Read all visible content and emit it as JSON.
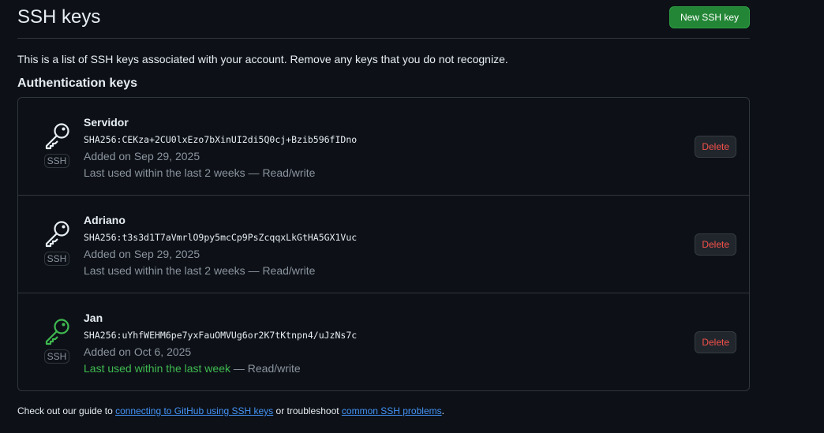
{
  "header": {
    "title": "SSH keys",
    "new_button": "New SSH key"
  },
  "intro": "This is a list of SSH keys associated with your account. Remove any keys that you do not recognize.",
  "section_title": "Authentication keys",
  "colors": {
    "accent_green": "#238636",
    "recent_green": "#3fb950",
    "danger": "#f85149",
    "link": "#4493f8"
  },
  "keys": [
    {
      "name": "Servidor",
      "fingerprint": "SHA256:CEKza+2CU0lxEzo7bXinUI2di5Q0cj+Bzib596fIDno",
      "added": "Added on Sep 29, 2025",
      "used_recent": "",
      "used": "Last used within the last 2 weeks — Read/write",
      "badge": "SSH",
      "delete_label": "Delete",
      "icon": "key-icon"
    },
    {
      "name": "Adriano",
      "fingerprint": "SHA256:t3s3d1T7aVmrlO9py5mcCp9PsZcqqxLkGtHA5GX1Vuc",
      "added": "Added on Sep 29, 2025",
      "used_recent": "",
      "used": "Last used within the last 2 weeks — Read/write",
      "badge": "SSH",
      "delete_label": "Delete",
      "icon": "key-icon"
    },
    {
      "name": "Jan",
      "fingerprint": "SHA256:uYhfWEHM6pe7yxFauOMVUg6or2K7tKtnpn4/uJzNs7c",
      "added": "Added on Oct 6, 2025",
      "used_recent": "Last used within the last week",
      "used": " — Read/write",
      "badge": "SSH",
      "delete_label": "Delete",
      "icon": "key-icon"
    }
  ],
  "footer": {
    "prefix": "Check out our guide to ",
    "link1": "connecting to GitHub using SSH keys",
    "middle": " or troubleshoot ",
    "link2": "common SSH problems",
    "suffix": "."
  }
}
